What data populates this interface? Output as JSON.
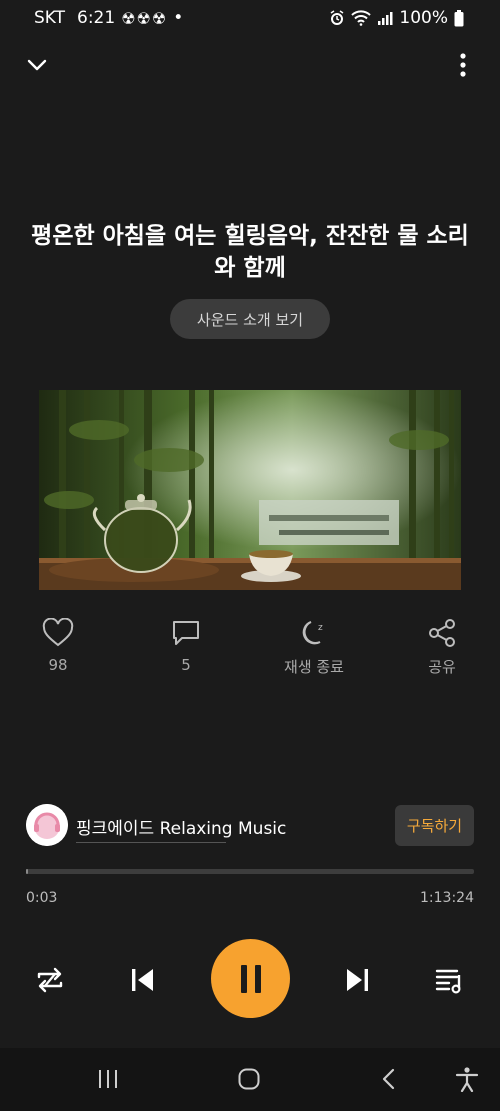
{
  "status_bar": {
    "carrier": "SKT",
    "time": "6:21",
    "radiation_icons": "☢☢☢",
    "dot": "•",
    "battery": "100%"
  },
  "track": {
    "title": "평온한 아침을 여는 힐링음악, 잔잔한 물 소리와 함께",
    "intro_label": "사운드 소개 보기"
  },
  "actions": {
    "like_count": "98",
    "comment_count": "5",
    "sleep_timer_label": "재생 종료",
    "share_label": "공유"
  },
  "channel": {
    "name": "핑크에이드 Relaxing Music",
    "subscribe_label": "구독하기"
  },
  "playback": {
    "current_time": "0:03",
    "total_time": "1:13:24",
    "progress": 0.0007,
    "state": "playing"
  },
  "colors": {
    "accent": "#f7a22f",
    "background": "#1b1b1b"
  },
  "icons": [
    "chevron-down-icon",
    "more-vertical-icon",
    "heart-icon",
    "comment-icon",
    "moon-icon",
    "share-icon",
    "repeat-icon",
    "previous-icon",
    "pause-icon",
    "next-icon",
    "playlist-icon"
  ]
}
